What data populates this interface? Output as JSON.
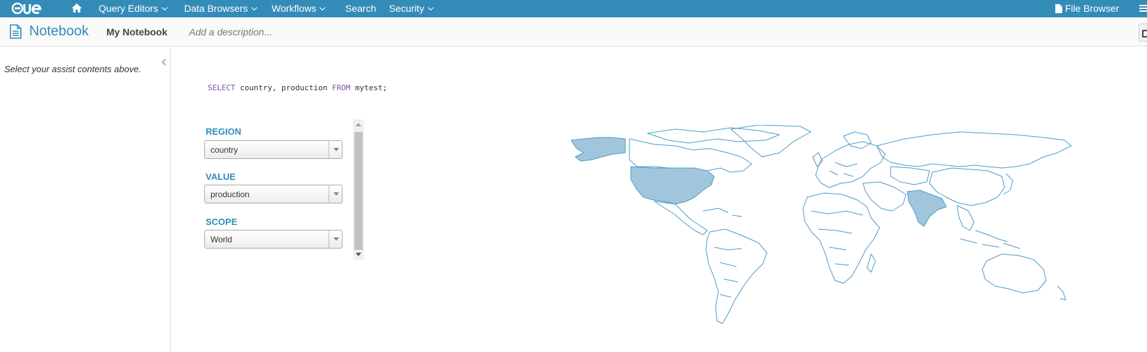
{
  "nav": {
    "logo": "HUE",
    "items": [
      {
        "label": "Query Editors",
        "dropdown": true
      },
      {
        "label": "Data Browsers",
        "dropdown": true
      },
      {
        "label": "Workflows",
        "dropdown": true
      },
      {
        "label": "Search",
        "dropdown": false
      },
      {
        "label": "Security",
        "dropdown": true
      }
    ],
    "file_browser": "File Browser"
  },
  "header": {
    "title": "Notebook",
    "notebook_name": "My Notebook",
    "description_placeholder": "Add a description..."
  },
  "assist": {
    "empty_text": "Select your assist contents above."
  },
  "query": {
    "kw_select": "SELECT",
    "cols": " country, production ",
    "kw_from": "FROM",
    "rest": " mytest;"
  },
  "settings": {
    "region": {
      "label": "REGION",
      "value": "country"
    },
    "value": {
      "label": "VALUE",
      "value": "production"
    },
    "scope": {
      "label": "SCOPE",
      "value": "World"
    }
  },
  "map": {
    "highlighted_countries": [
      "Alaska (US)",
      "United States",
      "India"
    ],
    "highlight_color": "#a1c6dc",
    "stroke_color": "#4a9bc7"
  },
  "colors": {
    "nav_bg": "#338bb8",
    "accent": "#338bb8",
    "keyword": "#7a55a5"
  }
}
